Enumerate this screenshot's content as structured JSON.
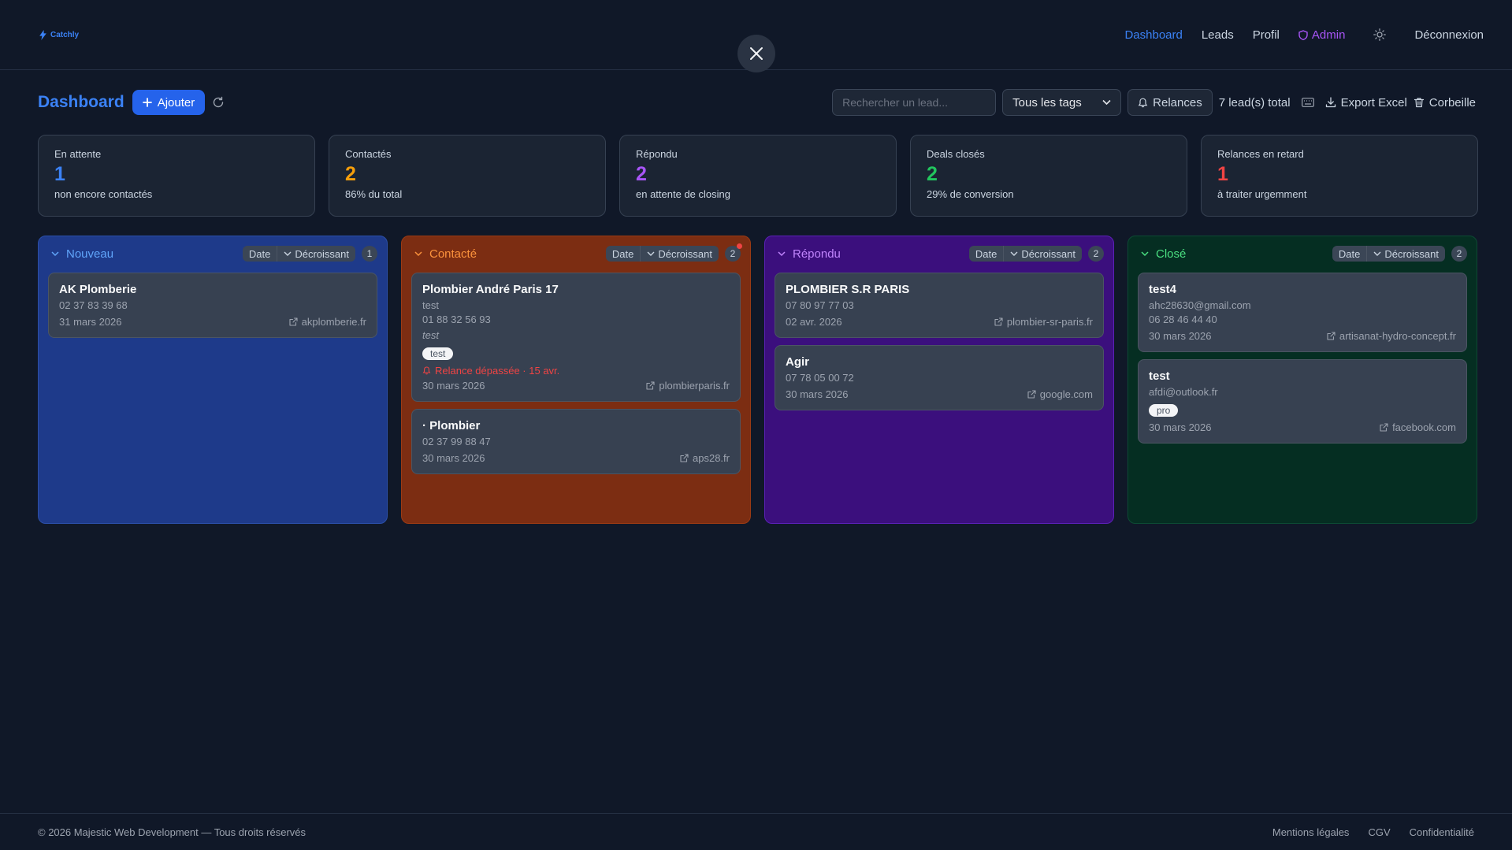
{
  "brand": {
    "name": "Catchly"
  },
  "nav": {
    "links": [
      "Dashboard",
      "Leads",
      "Profil",
      "Admin"
    ],
    "logout": "Déconnexion"
  },
  "toolbar": {
    "title": "Dashboard",
    "add_label": "Ajouter",
    "search_placeholder": "Rechercher un lead...",
    "tag_filter": "Tous les tags",
    "relances_label": "Relances",
    "total": "7 lead(s) total",
    "export_label": "Export Excel",
    "trash_label": "Corbeille"
  },
  "stats": [
    {
      "label": "En attente",
      "value": "1",
      "sub": "non encore contactés",
      "color": "#3b82f6"
    },
    {
      "label": "Contactés",
      "value": "2",
      "sub": "86% du total",
      "color": "#f59e0b"
    },
    {
      "label": "Répondu",
      "value": "2",
      "sub": "en attente de closing",
      "color": "#a855f7"
    },
    {
      "label": "Deals closés",
      "value": "2",
      "sub": "29% de conversion",
      "color": "#22c55e"
    },
    {
      "label": "Relances en retard",
      "value": "1",
      "sub": "à traiter urgemment",
      "color": "#ef4444"
    }
  ],
  "columns": [
    {
      "title": "Nouveau",
      "sort_field": "Date",
      "sort_order": "Décroissant",
      "count": "1",
      "bg": "#1e3a8a",
      "border": "#2b4fa8",
      "title_color": "#60a5fa",
      "cards": [
        {
          "name": "AK Plomberie",
          "lines": [
            "02 37 83 39 68"
          ],
          "date": "31 mars 2026",
          "site": "akplomberie.fr"
        }
      ]
    },
    {
      "title": "Contacté",
      "sort_field": "Date",
      "sort_order": "Décroissant",
      "count": "2",
      "bg": "#7c2d12",
      "border": "#9a3a14",
      "title_color": "#fb923c",
      "cards": [
        {
          "name": "Plombier André Paris 17",
          "lines": [
            "test",
            "01 88 32 56 93"
          ],
          "note": "test",
          "tag": "test",
          "overdue": "Relance dépassée · 15 avr.",
          "date": "30 mars 2026",
          "site": "plombierparis.fr"
        },
        {
          "name": "· Plombier",
          "lines": [
            "02 37 99 88 47"
          ],
          "date": "30 mars 2026",
          "site": "aps28.fr"
        }
      ]
    },
    {
      "title": "Répondu",
      "sort_field": "Date",
      "sort_order": "Décroissant",
      "count": "2",
      "bg": "#3b0f7d",
      "border": "#5b21b6",
      "title_color": "#c084fc",
      "cards": [
        {
          "name": "PLOMBIER S.R PARIS",
          "lines": [
            "07 80 97 77 03"
          ],
          "date": "02 avr. 2026",
          "site": "plombier-sr-paris.fr"
        },
        {
          "name": "Agir",
          "lines": [
            "07 78 05 00 72"
          ],
          "date": "30 mars 2026",
          "site": "google.com"
        }
      ]
    },
    {
      "title": "Closé",
      "sort_field": "Date",
      "sort_order": "Décroissant",
      "count": "2",
      "bg": "#052e22",
      "border": "#0d4a34",
      "title_color": "#4ade80",
      "cards": [
        {
          "name": "test4",
          "lines": [
            "ahc28630@gmail.com",
            "06 28 46 44 40"
          ],
          "date": "30 mars 2026",
          "site": "artisanat-hydro-concept.fr"
        },
        {
          "name": "test",
          "lines": [
            "afdi@outlook.fr"
          ],
          "tag": "pro",
          "date": "30 mars 2026",
          "site": "facebook.com"
        }
      ]
    }
  ],
  "footer": {
    "copyright": "© 2026 Majestic Web Development — Tous droits réservés",
    "links": [
      "Mentions légales",
      "CGV",
      "Confidentialité"
    ]
  }
}
